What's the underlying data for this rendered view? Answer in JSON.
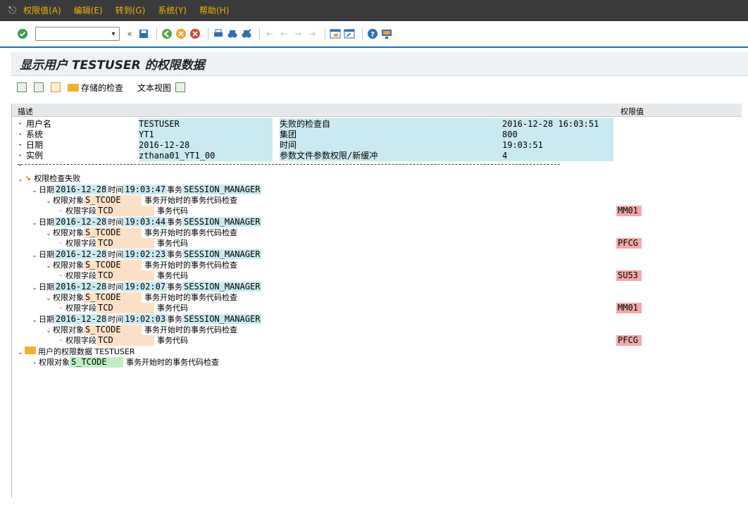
{
  "menubar": {
    "items": [
      "权限值(A)",
      "编辑(E)",
      "转到(G)",
      "系统(Y)",
      "帮助(H)"
    ]
  },
  "toolbar": {
    "command_value": "",
    "icons": [
      "check-icon",
      "back-icon",
      "save-icon",
      "nav-back-icon",
      "exit-icon",
      "cancel-icon",
      "print-icon",
      "find-icon",
      "find-next-icon",
      "first-page-icon",
      "prev-page-icon",
      "next-page-icon",
      "last-page-icon",
      "new-session-icon",
      "shortcut-icon",
      "help-icon",
      "customize-icon"
    ]
  },
  "title": "显示用户 TESTUSER 的权限数据",
  "app_toolbar": {
    "stored_check": "存储的检查",
    "text_view": "文本视图"
  },
  "columns": {
    "description": "描述",
    "auth_value": "权限值"
  },
  "header_info": [
    {
      "label": "用户名",
      "value": "TESTUSER",
      "label2": "失败的检查自",
      "value2": "2016-12-28 16:03:51"
    },
    {
      "label": "系统",
      "value": "YT1",
      "label2": "集团",
      "value2": "800"
    },
    {
      "label": "日期",
      "value": "2016-12-28",
      "label2": "时间",
      "value2": "19:03:51"
    },
    {
      "label": "实例",
      "value": "zthana01_YT1_00",
      "label2": "参数文件参数权限/新缓冲",
      "value2": "4"
    }
  ],
  "failed_checks": {
    "label": "权限检查失败",
    "entries": [
      {
        "date": "2016-12-28",
        "time": "19:03:47",
        "tx": "SESSION_MANAGER",
        "obj": "S_TCODE",
        "obj_desc": "事务开始时的事务代码检查",
        "field": "TCD",
        "field_desc": "事务代码",
        "value": "MM01"
      },
      {
        "date": "2016-12-28",
        "time": "19:03:44",
        "tx": "SESSION_MANAGER",
        "obj": "S_TCODE",
        "obj_desc": "事务开始时的事务代码检查",
        "field": "TCD",
        "field_desc": "事务代码",
        "value": "PFCG"
      },
      {
        "date": "2016-12-28",
        "time": "19:02:23",
        "tx": "SESSION_MANAGER",
        "obj": "S_TCODE",
        "obj_desc": "事务开始时的事务代码检查",
        "field": "TCD",
        "field_desc": "事务代码",
        "value": "SU53"
      },
      {
        "date": "2016-12-28",
        "time": "19:02:07",
        "tx": "SESSION_MANAGER",
        "obj": "S_TCODE",
        "obj_desc": "事务开始时的事务代码检查",
        "field": "TCD",
        "field_desc": "事务代码",
        "value": "MM01"
      },
      {
        "date": "2016-12-28",
        "time": "19:02:03",
        "tx": "SESSION_MANAGER",
        "obj": "S_TCODE",
        "obj_desc": "事务开始时的事务代码检查",
        "field": "TCD",
        "field_desc": "事务代码",
        "value": "PFCG"
      }
    ]
  },
  "labels": {
    "date": "日期",
    "time": "时间",
    "tx": "事务",
    "auth_obj": "权限对象",
    "auth_field": "权限字段"
  },
  "user_auth": {
    "label": "用户的权限数据 TESTUSER",
    "obj_label": "权限对象",
    "obj": "S_TCODE",
    "obj_desc": "事务开始时的事务代码检查"
  },
  "colors": {
    "menubar_bg": "#3a3a3a",
    "menu_text": "#f0b400",
    "teal_highlight": "#c9eaf0",
    "peach_highlight": "#fde1c7",
    "green_highlight": "#bfeec4",
    "red_highlight": "#f3a8a8",
    "accent_blue": "#1a70b8"
  }
}
